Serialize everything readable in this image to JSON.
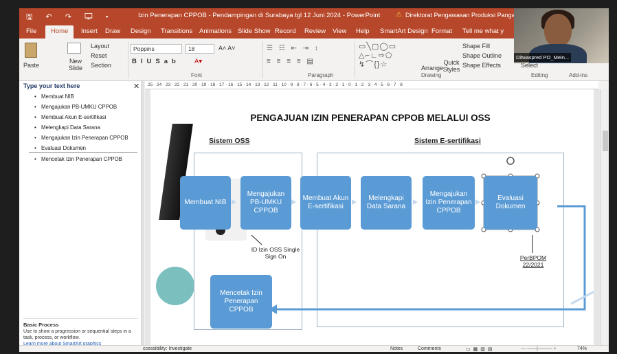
{
  "titlebar": {
    "quick_access": "🖫 ↶ ↷ 🖵 ▾",
    "doc_title": "Izin Penerapan CPPOB - Pendampingan di Surabaya tgl 12 Juni 2024 - PowerPoint",
    "notice": "Direktorat Pengawasan Produksi Pangan Olahan"
  },
  "tabs": [
    "File",
    "Home",
    "Insert",
    "Draw",
    "Design",
    "Transitions",
    "Animations",
    "Slide Show",
    "Record",
    "Review",
    "View",
    "Help",
    "SmartArt Design",
    "Format",
    "Tell me what y"
  ],
  "ribbon": {
    "paste": "Paste",
    "new_slide": "New Slide",
    "layout": "Layout",
    "reset": "Reset",
    "section": "Section",
    "font_name": "Poppins",
    "font_size": "18",
    "shape_fill": "Shape Fill",
    "shape_outline": "Shape Outline",
    "shape_effects": "Shape Effects",
    "arrange": "Arrange",
    "quick_styles": "Quick Styles",
    "select": "Select",
    "groups": {
      "font": "Font",
      "paragraph": "Paragraph",
      "drawing": "Drawing",
      "editing": "Editing",
      "addins": "Add-ins"
    }
  },
  "camera": {
    "name": "Ditwaspred PO_Mein..."
  },
  "text_pane": {
    "header": "Type your text here",
    "items": [
      "Membuat NIB",
      "Mengajukan PB-UMKU CPPOB",
      "Membuat Akun E-sertifikasi",
      "Melengkapi Data Sarana",
      "Mengajukan Izin Penerapan CPPOB",
      "Evaluasi Dokumen",
      "Mencetak Izin Penerapan CPPOB"
    ],
    "info_title": "Basic Process",
    "info_text": "Use to show a progression or sequential steps in a task, process, or workflow.",
    "info_link": "Learn more about SmartArt graphics"
  },
  "ruler": "25 · 24 · 23 · 22 · 21 · 20 · 19 · 18 · 17 · 16 · 15 · 14 · 13 · 12 · 11 · 10 · 9 · 8 · 7 · 6 · 5 · 4 · 3 · 2 · 1 · 0 · 1 · 2 · 3 · 4 · 5 · 6 · 7 · 8",
  "slide": {
    "title": "PENGAJUAN IZIN PENERAPAN CPPOB MELALUI OSS",
    "section_oss": "Sistem OSS",
    "section_es": "Sistem E-sertifikasi",
    "boxes": [
      "Membuat NIB",
      "Mengajukan PB-UMKU CPPOB",
      "Membuat Akun E-sertifikasi",
      "Melengkapi Data Sarana",
      "Mengajukan Izin Penerapan CPPOB",
      "Evaluasi Dokumen",
      "Mencetak Izin Penerapan CPPOB"
    ],
    "note_oss": "ID Izin OSS Single Sign On",
    "note_perbpom": "PerBPOM 22/2021"
  },
  "status": {
    "accessibility": "ccessibility: Investigate",
    "notes": "Notes",
    "comments": "Comments",
    "zoom": "74%"
  },
  "colors": {
    "accent": "#b7472a",
    "box": "#5b9bd5",
    "arrow": "#5b9bd5"
  }
}
